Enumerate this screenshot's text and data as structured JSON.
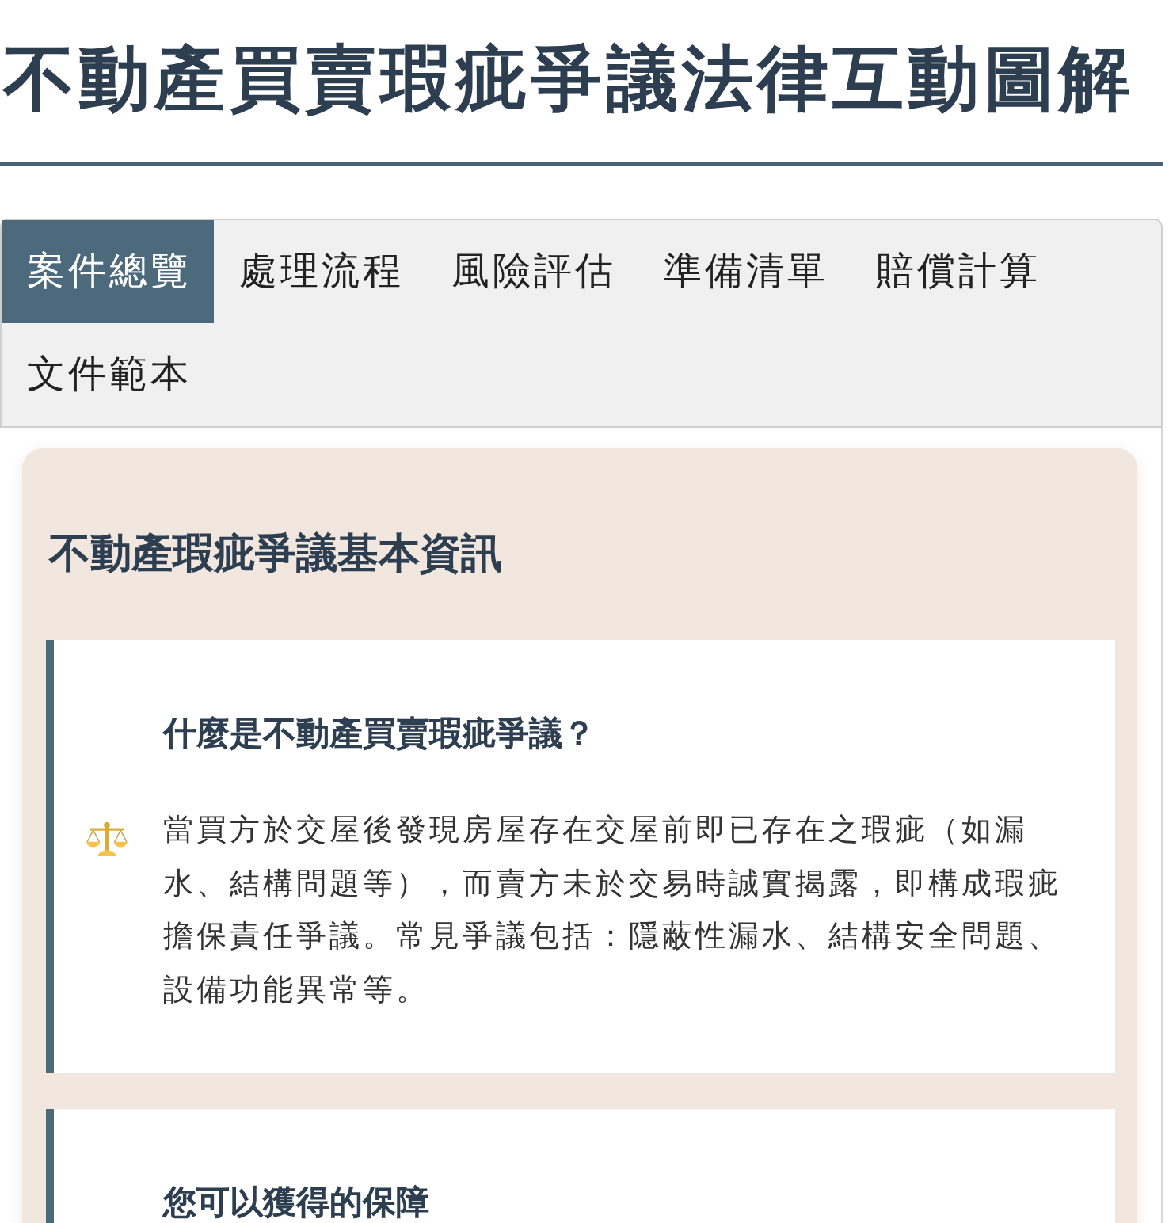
{
  "page": {
    "title": "不動產買賣瑕疵爭議法律互動圖解"
  },
  "tabs": [
    {
      "label": "案件總覽",
      "selected": true
    },
    {
      "label": "處理流程",
      "selected": false
    },
    {
      "label": "風險評估",
      "selected": false
    },
    {
      "label": "準備清單",
      "selected": false
    },
    {
      "label": "賠償計算",
      "selected": false
    },
    {
      "label": "文件範本",
      "selected": false
    }
  ],
  "section": {
    "heading": "不動產瑕疵爭議基本資訊",
    "cards": [
      {
        "title": "什麼是不動產買賣瑕疵爭議？",
        "text": "當買方於交屋後發現房屋存在交屋前即已存在之瑕疵（如漏水、結構問題等），而賣方未於交易時誠實揭露，即構成瑕疵擔保責任爭議。常見爭議包括：隱蔽性漏水、結構安全問題、設備功能異常等。"
      },
      {
        "title": "您可以獲得的保障"
      }
    ]
  }
}
